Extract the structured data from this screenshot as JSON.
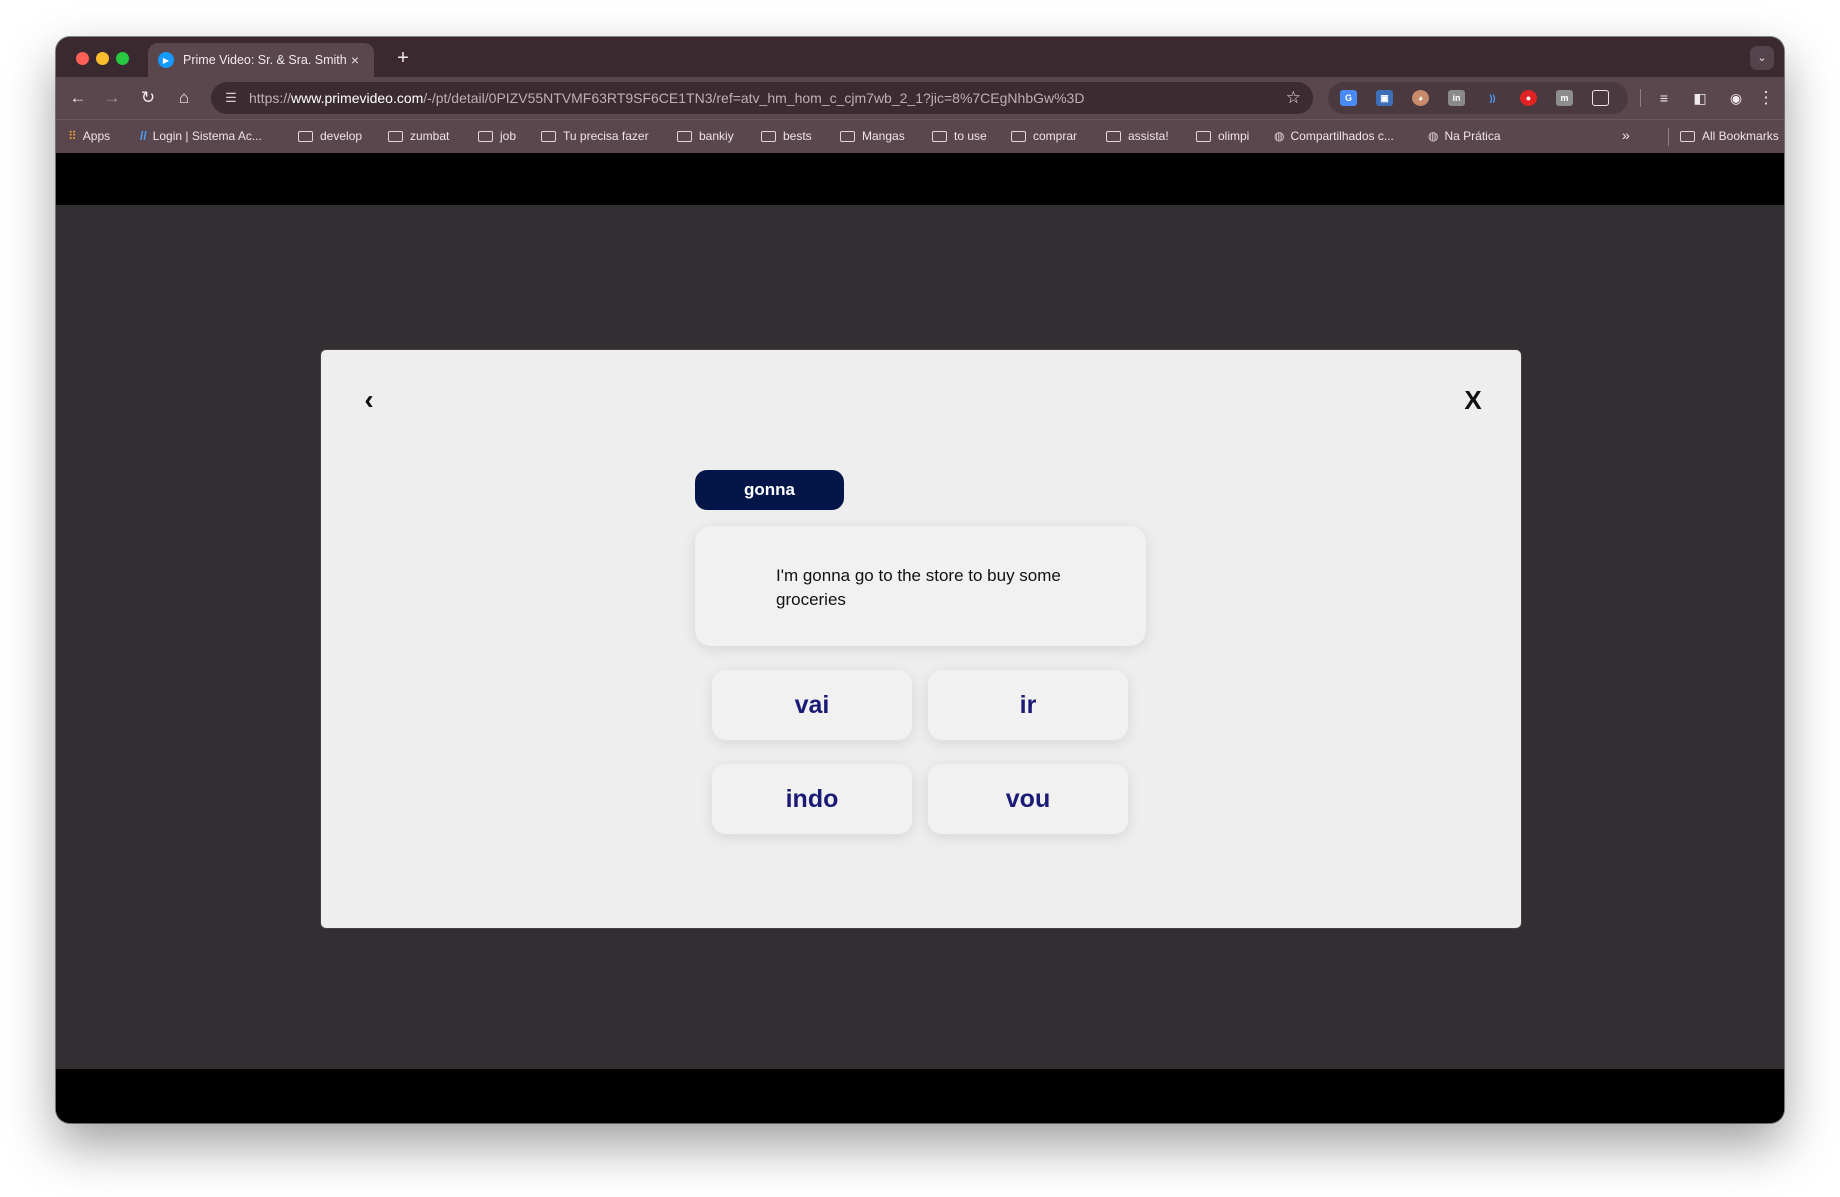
{
  "browser": {
    "tab": {
      "title": "Prime Video: Sr. & Sra. Smith",
      "close": "×"
    },
    "new_tab": "+",
    "tab_menu": "⌄",
    "toolbar": {
      "back": "←",
      "forward": "→",
      "reload": "↻",
      "home": "⌂",
      "url_prefix": "https://",
      "url_domain": "www.primevideo.com",
      "url_path": "/-/pt/detail/0PIZV55NTVMF63RT9SF6CE1TN3/ref=atv_hm_hom_c_cjm7wb_2_1?jic=8%7CEgNhbGw%3D",
      "star": "☆",
      "menu": "⋮"
    },
    "extensions": [
      "translate",
      "screen",
      "cat",
      "linkedin",
      "wave",
      "record",
      "m",
      "puzzle"
    ],
    "bookmarks": [
      {
        "label": "Apps",
        "type": "apps"
      },
      {
        "label": "Login | Sistema Ac...",
        "type": "link"
      },
      {
        "label": "develop",
        "type": "folder"
      },
      {
        "label": "zumbat",
        "type": "folder"
      },
      {
        "label": "job",
        "type": "folder"
      },
      {
        "label": "Tu precisa fazer",
        "type": "folder"
      },
      {
        "label": "bankiy",
        "type": "folder"
      },
      {
        "label": "bests",
        "type": "folder"
      },
      {
        "label": "Mangas",
        "type": "folder"
      },
      {
        "label": "to use",
        "type": "folder"
      },
      {
        "label": "comprar",
        "type": "folder"
      },
      {
        "label": "assista!",
        "type": "folder"
      },
      {
        "label": "olimpi",
        "type": "folder"
      },
      {
        "label": "Compartilhados c...",
        "type": "globe"
      },
      {
        "label": "Na Prática",
        "type": "globe"
      }
    ],
    "bookmarks_overflow": "»",
    "all_bookmarks": "All Bookmarks"
  },
  "quiz": {
    "back": "‹",
    "close": "X",
    "word": "gonna",
    "sentence": "I'm gonna go to the store to buy some groceries",
    "options": [
      "vai",
      "ir",
      "indo",
      "vou"
    ]
  }
}
